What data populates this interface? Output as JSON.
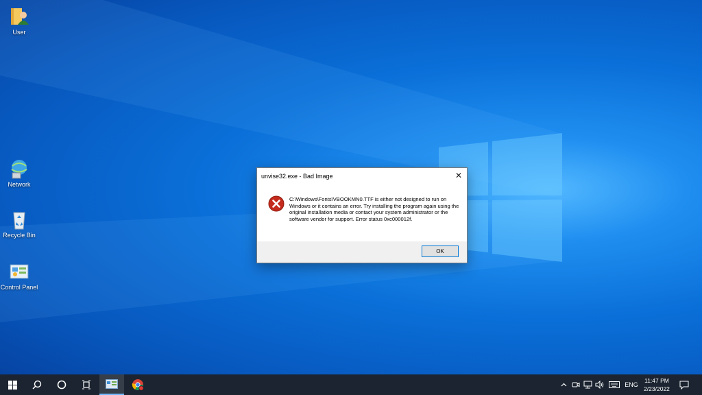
{
  "desktop": {
    "icons": [
      {
        "label": "User",
        "icon": "user-folder-icon"
      },
      {
        "label": "Network",
        "icon": "network-icon"
      },
      {
        "label": "Recycle Bin",
        "icon": "recycle-bin-icon"
      },
      {
        "label": "Control Panel",
        "icon": "control-panel-icon"
      }
    ]
  },
  "dialog": {
    "title": "unvise32.exe - Bad Image",
    "message": "C:\\Windows\\Fonts\\VBOOKMN0.TTF is either not designed to run on Windows or it contains an error. Try installing the program again using the original installation media or contact your system administrator or the software vendor for support. Error status 0xc000012f.",
    "ok_label": "OK",
    "icon": "error-icon"
  },
  "taskbar": {
    "tray": {
      "language": "ENG",
      "time": "11:47 PM",
      "date": "2/23/2022"
    }
  },
  "colors": {
    "taskbar": "#1b2430",
    "accent": "#0078d7",
    "error": "#c42b1c"
  }
}
